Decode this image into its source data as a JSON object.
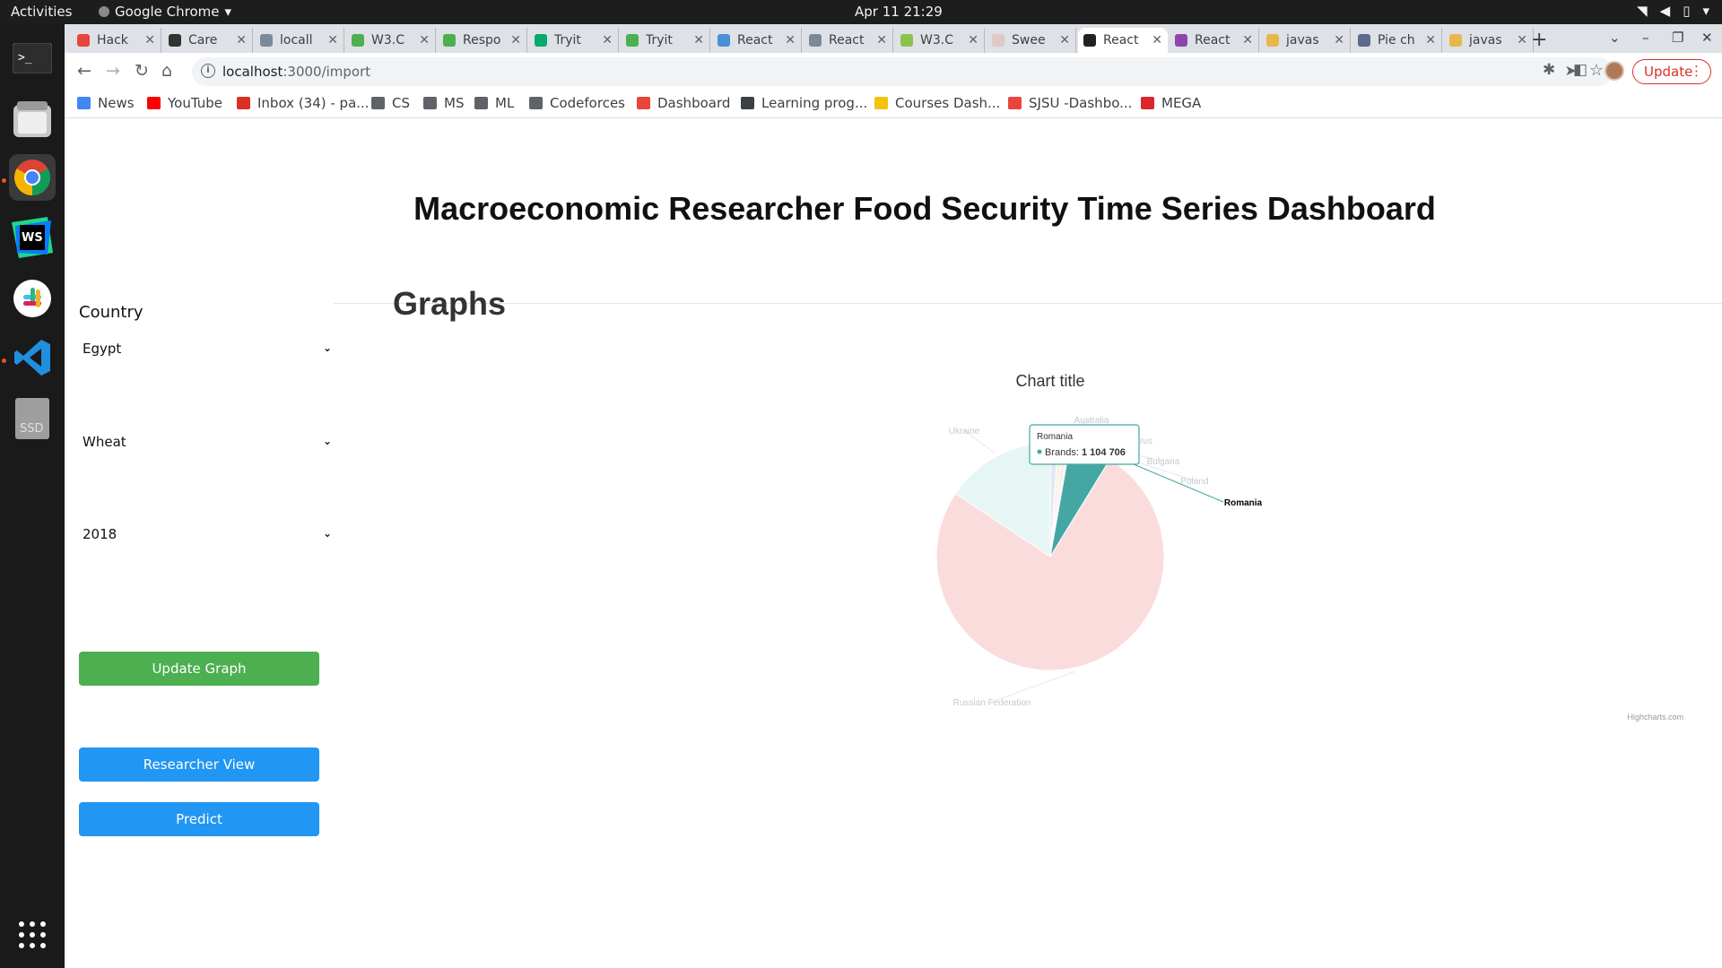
{
  "system": {
    "activities": "Activities",
    "app_name": "Google Chrome",
    "clock": "Apr 11  21:29"
  },
  "tabs": [
    {
      "label": "Hack",
      "color": "#e8453c"
    },
    {
      "label": "Care",
      "color": "#333333"
    },
    {
      "label": "locall",
      "color": "#7a8a99"
    },
    {
      "label": "W3.C",
      "color": "#4caf50"
    },
    {
      "label": "Respo",
      "color": "#4caf50"
    },
    {
      "label": "Tryit",
      "color": "#04aa6d"
    },
    {
      "label": "Tryit",
      "color": "#4caf50"
    },
    {
      "label": "React",
      "color": "#4a90d9"
    },
    {
      "label": "React",
      "color": "#7a8a99"
    },
    {
      "label": "W3.C",
      "color": "#8bc34a"
    },
    {
      "label": "Swee",
      "color": "#e0c8c8"
    },
    {
      "label": "React",
      "color": "#222222",
      "active": true
    },
    {
      "label": "React",
      "color": "#8e44ad"
    },
    {
      "label": "javas",
      "color": "#e6b84a"
    },
    {
      "label": "Pie ch",
      "color": "#5a6b8c"
    },
    {
      "label": "javas",
      "color": "#e6b84a"
    }
  ],
  "toolbar": {
    "url_host": "localhost",
    "url_path": ":3000/import",
    "update_label": "Update"
  },
  "bookmarks": [
    {
      "label": "News",
      "color": "#4285f4"
    },
    {
      "label": "YouTube",
      "color": "#ff0000"
    },
    {
      "label": "Inbox (34) - pa...",
      "color": "#d93025"
    },
    {
      "label": "CS",
      "color": "#5f6368"
    },
    {
      "label": "MS",
      "color": "#5f6368"
    },
    {
      "label": "ML",
      "color": "#5f6368"
    },
    {
      "label": "Codeforces",
      "color": "#5f6368"
    },
    {
      "label": "Dashboard",
      "color": "#e8453c"
    },
    {
      "label": "Learning prog...",
      "color": "#3c4043"
    },
    {
      "label": "Courses Dash...",
      "color": "#f4c20d"
    },
    {
      "label": "SJSU -Dashbo...",
      "color": "#e8453c"
    },
    {
      "label": "MEGA",
      "color": "#d9272e"
    }
  ],
  "page": {
    "title": "Macroeconomic Researcher Food Security Time Series Dashboard",
    "graphs_heading": "Graphs"
  },
  "sidebar": {
    "country_label": "Country",
    "country_value": "Egypt",
    "commodity_value": "Wheat",
    "year_value": "2018",
    "update_button": "Update Graph",
    "researcher_button": "Researcher View",
    "predict_button": "Predict"
  },
  "chart_data": {
    "type": "pie",
    "title": "Chart title",
    "series_name": "Brands",
    "slices": [
      {
        "name": "Russian Federation",
        "value": 14000000,
        "color": "#fbdcdc"
      },
      {
        "name": "Ukraine",
        "value": 2900000,
        "color": "#e6f6f4"
      },
      {
        "name": "Australia",
        "value": 200000,
        "color": "#e3e8f5"
      },
      {
        "name": "Belarus",
        "value": 150000,
        "color": "#faf3e3"
      },
      {
        "name": "Bulgaria",
        "value": 100000,
        "color": "#f3ecec"
      },
      {
        "name": "Poland",
        "value": 60000,
        "color": "#f0f0f0"
      },
      {
        "name": "Romania",
        "value": 1104706,
        "color": "#45a7a4"
      }
    ],
    "highlighted": "Romania",
    "tooltip": {
      "name": "Romania",
      "series": "Brands",
      "value_text": "1 104 706"
    },
    "credits": "Highcharts.com"
  }
}
